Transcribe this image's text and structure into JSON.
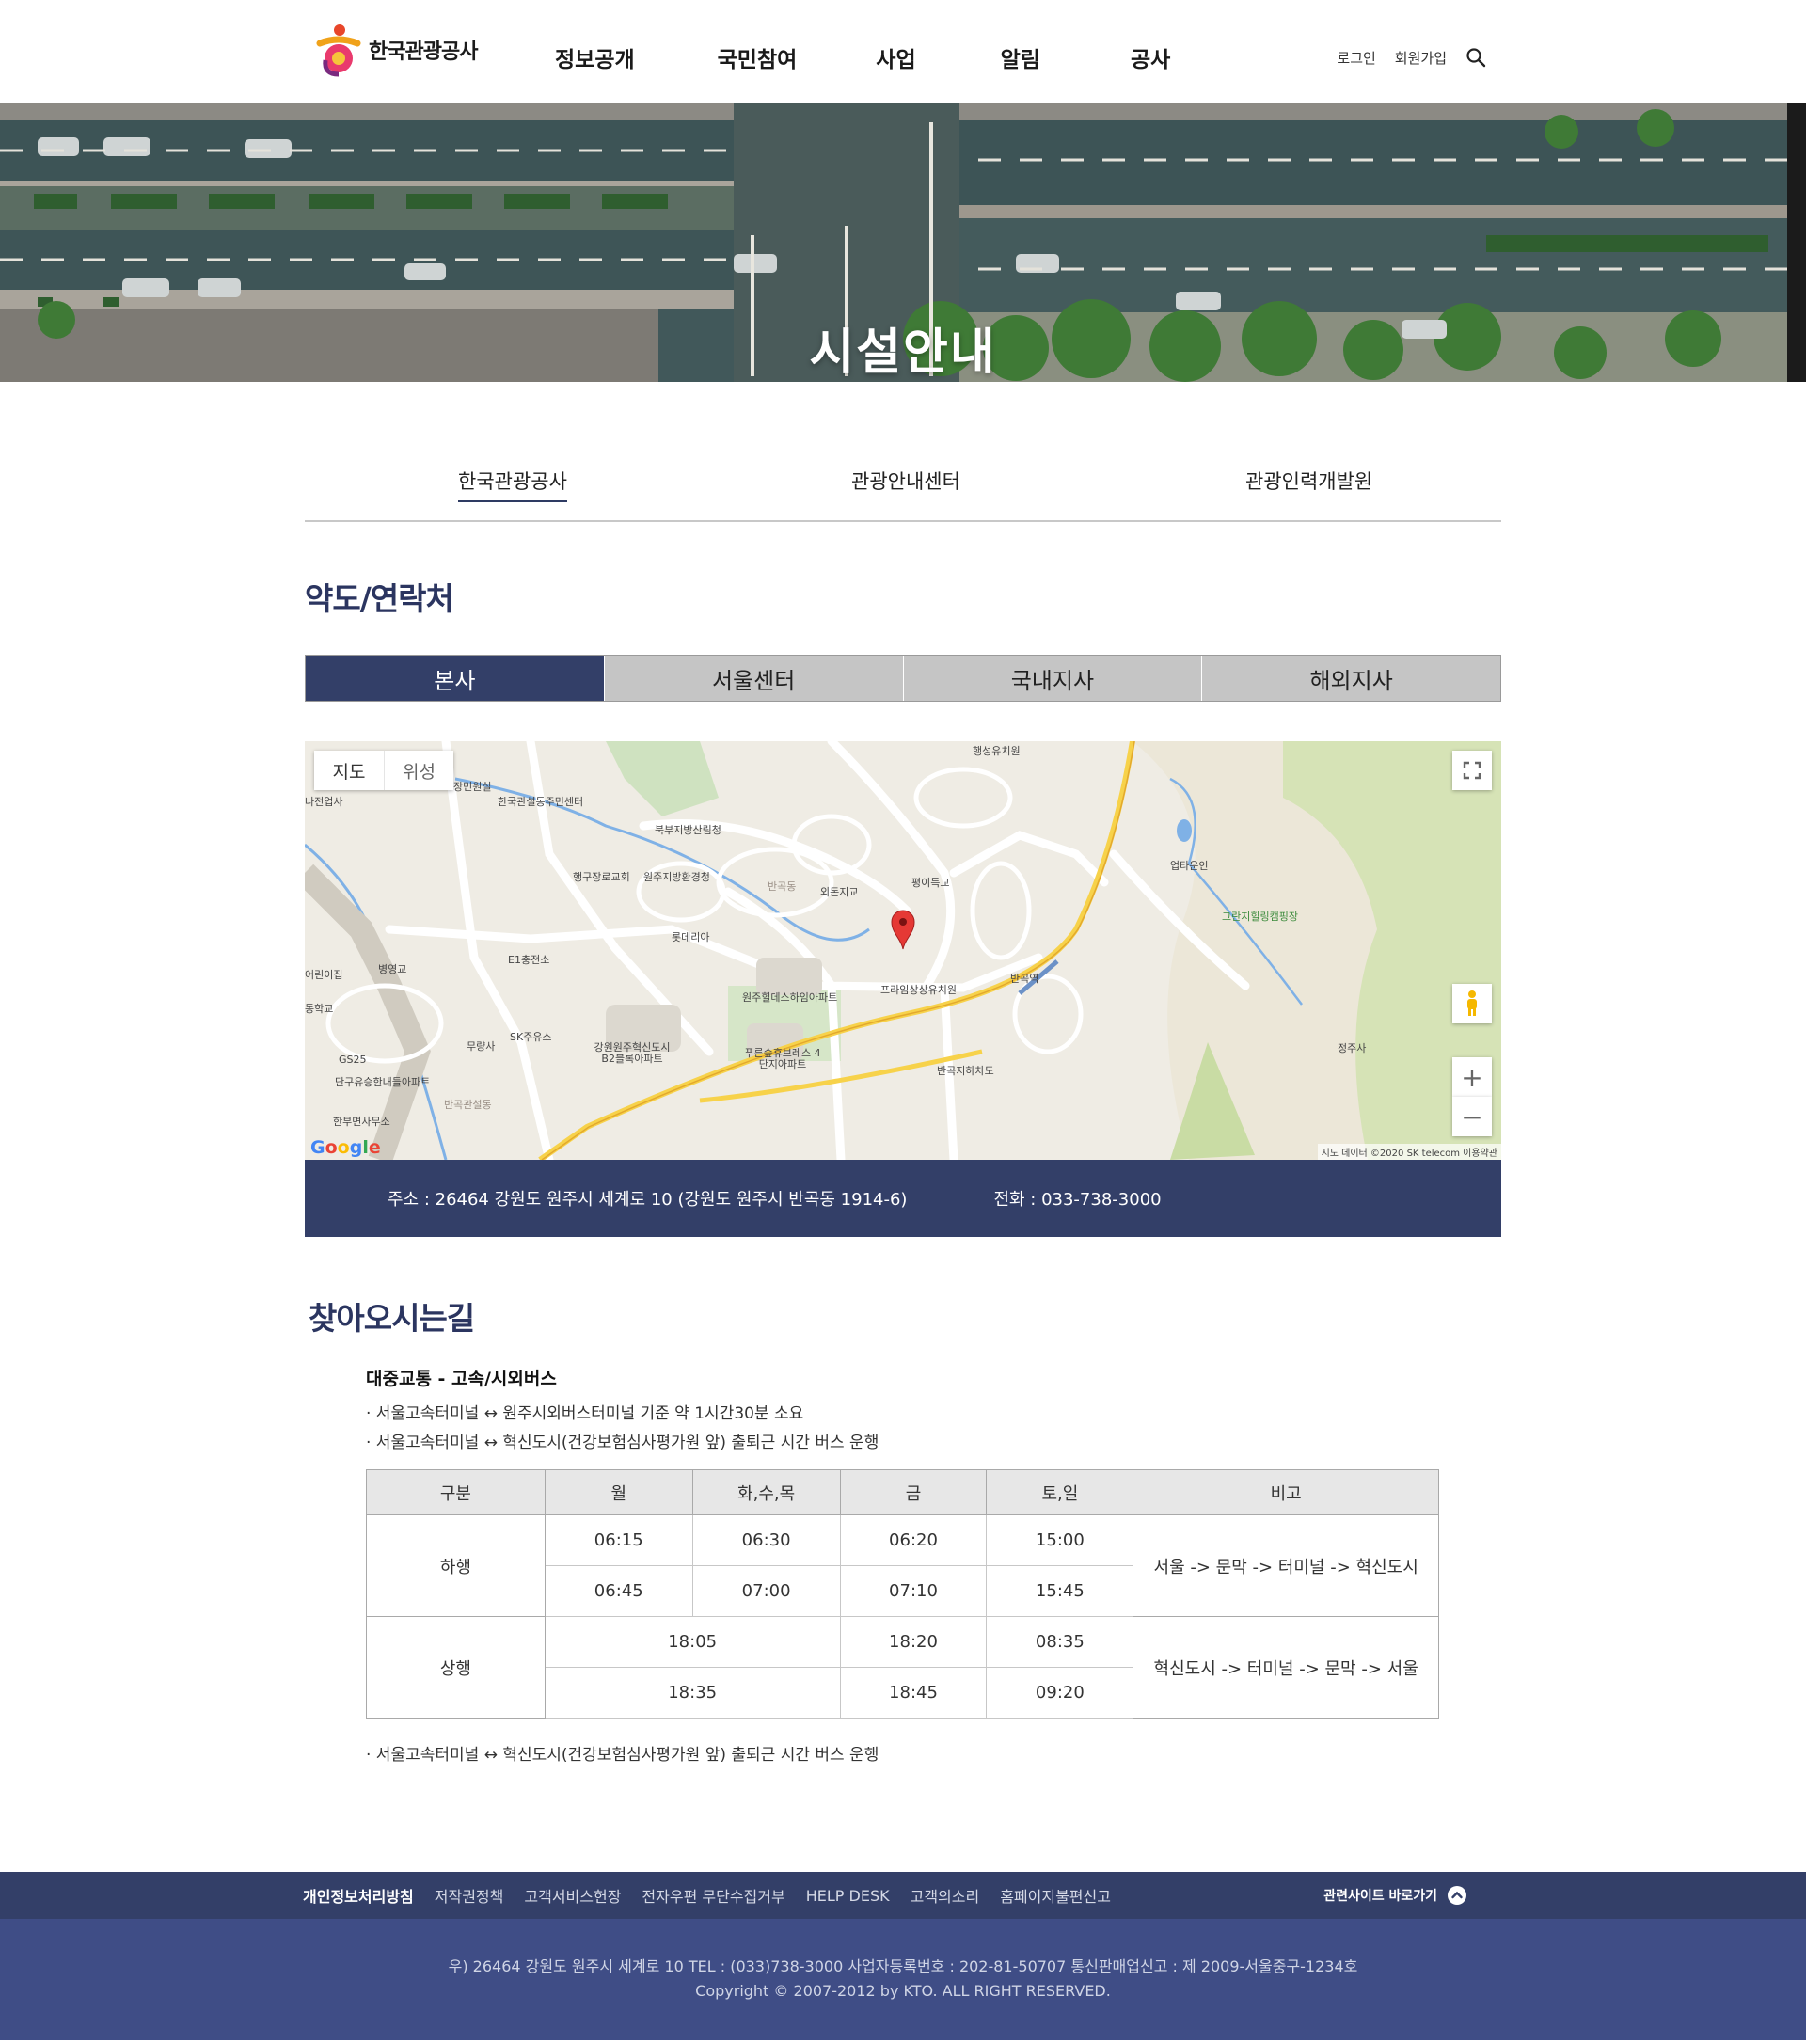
{
  "header": {
    "logo_text": "한국관광공사",
    "nav": [
      "정보공개",
      "국민참여",
      "사업",
      "알림",
      "공사"
    ],
    "util": {
      "login": "로그인",
      "signup": "회원가입"
    }
  },
  "hero": {
    "title": "시설안내"
  },
  "subtabs": [
    {
      "label": "한국관광공사",
      "active": true
    },
    {
      "label": "관광안내센터",
      "active": false
    },
    {
      "label": "관광인력개발원",
      "active": false
    }
  ],
  "section_title": "약도/연락처",
  "location_tabs": [
    {
      "label": "본사",
      "active": true
    },
    {
      "label": "서울센터",
      "active": false
    },
    {
      "label": "국내지사",
      "active": false
    },
    {
      "label": "해외지사",
      "active": false
    }
  ],
  "map": {
    "type_map": "지도",
    "type_satellite": "위성",
    "credit": "지도 데이터 ©2020 SK telecom   이용약관",
    "labels": [
      "행성유치원",
      "장민원실",
      "한국관설동주민센터",
      "나전업사",
      "북부지방산림청",
      "행구장로교회",
      "원주지방환경청",
      "반곡동",
      "외돈지교",
      "평이득교",
      "업타운인",
      "그란지힐링캠핑장",
      "롯데리아",
      "E1충전소",
      "병영교",
      "원주힐데스하임아파트",
      "프라임상상유치원",
      "반곡역",
      "어린이집",
      "동학교",
      "SK주유소",
      "무량사",
      "강원원주혁신도시 B2블록아파트",
      "푸른숲휴브레스 4단지아파트",
      "반곡지하차도",
      "GS25",
      "단구유승한내들아파트",
      "한부면사무소",
      "반곡관설동",
      "정주사"
    ]
  },
  "contact": {
    "address": "주소 : 26464 강원도 원주시 세계로 10 (강원도 원주시 반곡동 1914-6)",
    "phone": "전화 : 033-738-3000"
  },
  "directions": {
    "title": "찾아오시는길",
    "subtitle": "대중교통 - 고속/시외버스",
    "bullets": [
      "· 서울고속터미널 ↔ 원주시외버스터미널 기준 약 1시간30분 소요",
      "· 서울고속터미널 ↔ 혁신도시(건강보험심사평가원 앞) 출퇴근 시간 버스 운행"
    ],
    "table": {
      "headers": [
        "구분",
        "월",
        "화,수,목",
        "금",
        "토,일",
        "비고"
      ],
      "down": {
        "label": "하행",
        "rows": [
          [
            "06:15",
            "06:30",
            "06:20",
            "15:00"
          ],
          [
            "06:45",
            "07:00",
            "07:10",
            "15:45"
          ]
        ],
        "note": "서울 -> 문막 -> 터미널 -> 혁신도시"
      },
      "up": {
        "label": "상행",
        "rows": [
          [
            "18:05",
            "18:20",
            "08:35"
          ],
          [
            "18:35",
            "18:45",
            "09:20"
          ]
        ],
        "note": "혁신도시 -> 터미널 -> 문막 -> 서울"
      }
    },
    "after_bullet": "· 서울고속터미널 ↔ 혁신도시(건강보험심사평가원 앞) 출퇴근 시간 버스 운행"
  },
  "footer": {
    "links": [
      "개인정보처리방침",
      "저작권정책",
      "고객서비스헌장",
      "전자우편 무단수집거부",
      "HELP DESK",
      "고객의소리",
      "홈페이지불편신고"
    ],
    "related": "관련사이트 바로가기",
    "address_line": "우) 26464 강원도 원주시 세계로 10 TEL : (033)738-3000 사업자등록번호 : 202-81-50707 통신판매업신고 : 제 2009-서울중구-1234호",
    "copyright": "Copyright © 2007-2012 by KTO. ALL RIGHT RESERVED."
  }
}
